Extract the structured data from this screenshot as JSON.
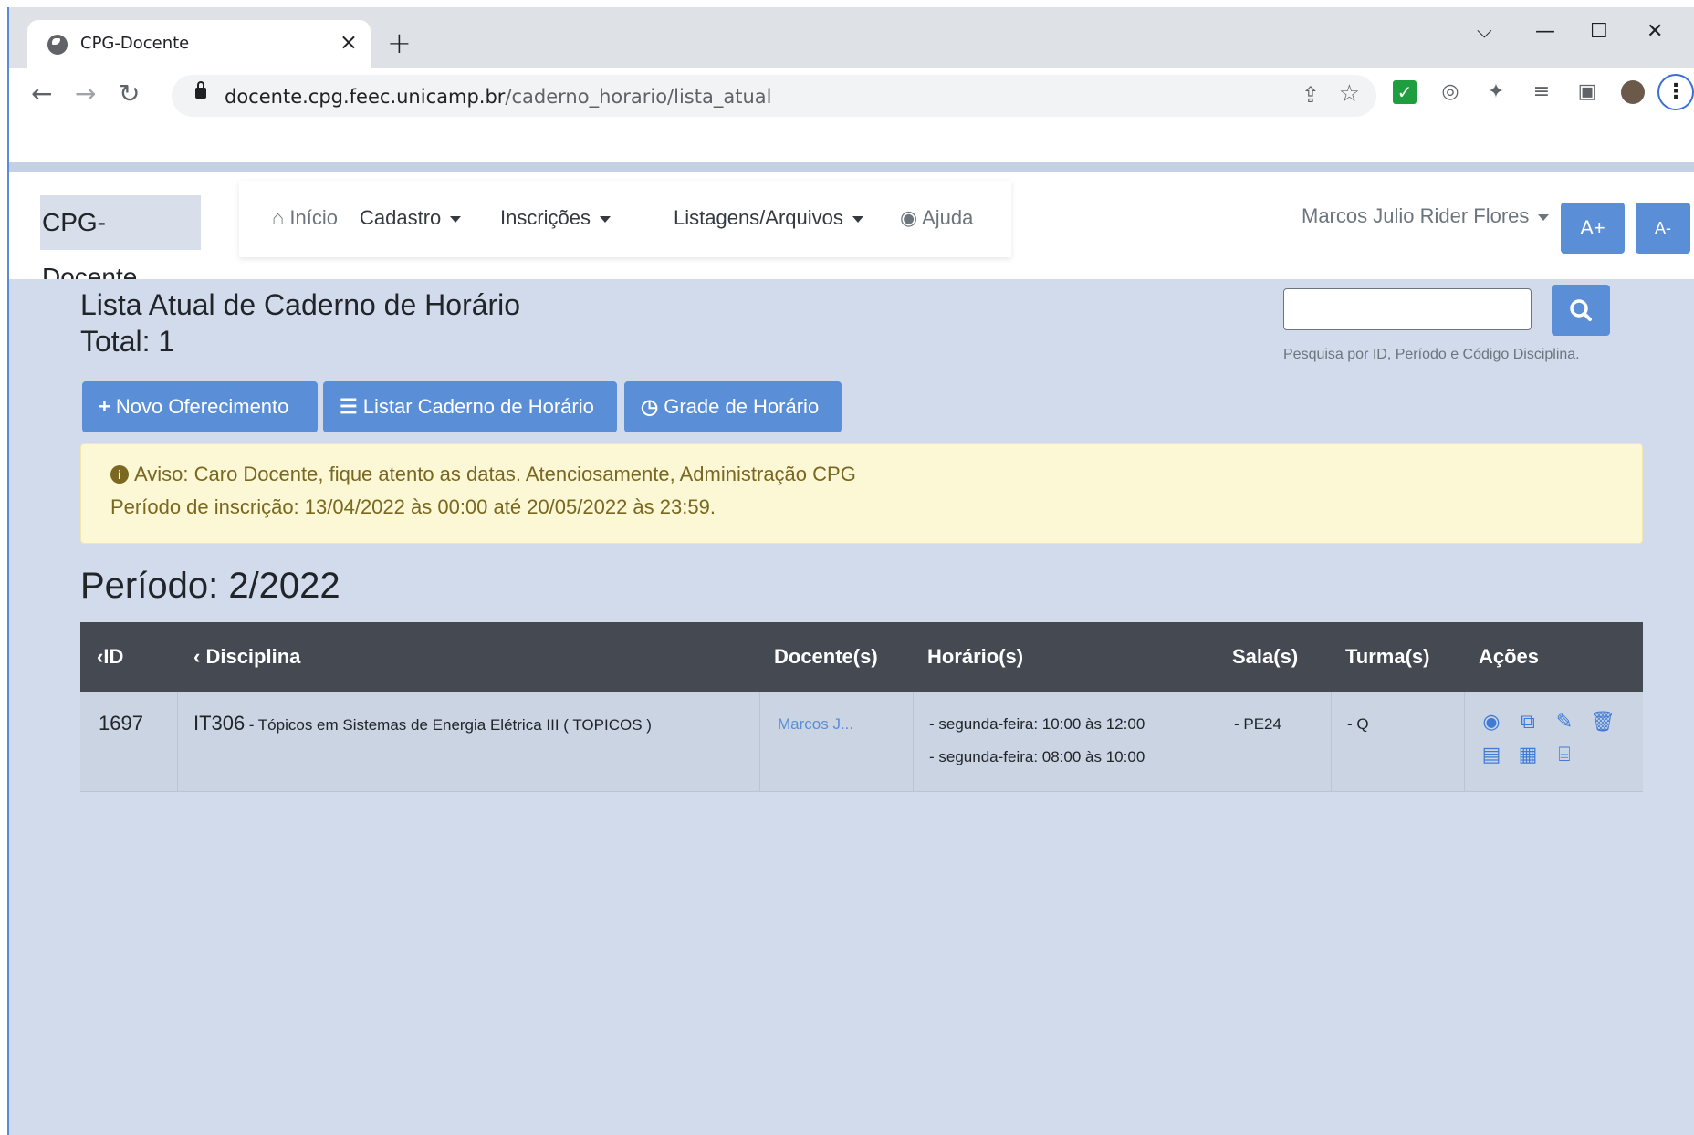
{
  "browser": {
    "tab_title": "CPG-Docente",
    "url_host": "docente.cpg.feec.unicamp.br",
    "url_path": "/caderno_horario/lista_atual"
  },
  "navbar": {
    "brand": "CPG-Docente",
    "items": {
      "inicio": "Início",
      "cadastro": "Cadastro",
      "inscricoes": "Inscrições",
      "listagens": "Listagens/Arquivos",
      "ajuda": "Ajuda"
    },
    "user_name": "Marcos Julio Rider Flores",
    "font_increase": "A+",
    "font_decrease": "A-"
  },
  "page": {
    "title": "Lista Atual de Caderno de Horário",
    "total": "Total: 1",
    "search": {
      "value": "",
      "help": "Pesquisa por ID, Período e Código Disciplina."
    },
    "actions": {
      "novo": "Novo Oferecimento",
      "listar": "Listar Caderno de Horário",
      "grade": "Grade de Horário"
    },
    "alert": {
      "line1": "Aviso: Caro Docente, fique atento as datas. Atenciosamente, Administração CPG",
      "line2": "Período de inscrição: 13/04/2022 às 00:00 até 20/05/2022 às 23:59."
    },
    "periodo": "Período: 2/2022"
  },
  "table": {
    "headers": {
      "id": "ID",
      "disciplina": "Disciplina",
      "docentes": "Docente(s)",
      "horarios": "Horário(s)",
      "salas": "Sala(s)",
      "turmas": "Turma(s)",
      "acoes": "Ações"
    },
    "rows": [
      {
        "id": "1697",
        "codigo": "IT306",
        "nome": "- Tópicos em Sistemas de Energia Elétrica III ( TOPICOS )",
        "docente": "Marcos J...",
        "horarios": [
          "- segunda-feira: 10:00 às 12:00",
          "- segunda-feira: 08:00 às 10:00"
        ],
        "sala": "- PE24",
        "turma": "- Q"
      }
    ]
  },
  "colors": {
    "primary": "#5a8fd8",
    "page_bg": "#d1dbeb",
    "table_header": "#454a52",
    "alert_bg": "#fcf7d5",
    "alert_text": "#7a6720"
  }
}
